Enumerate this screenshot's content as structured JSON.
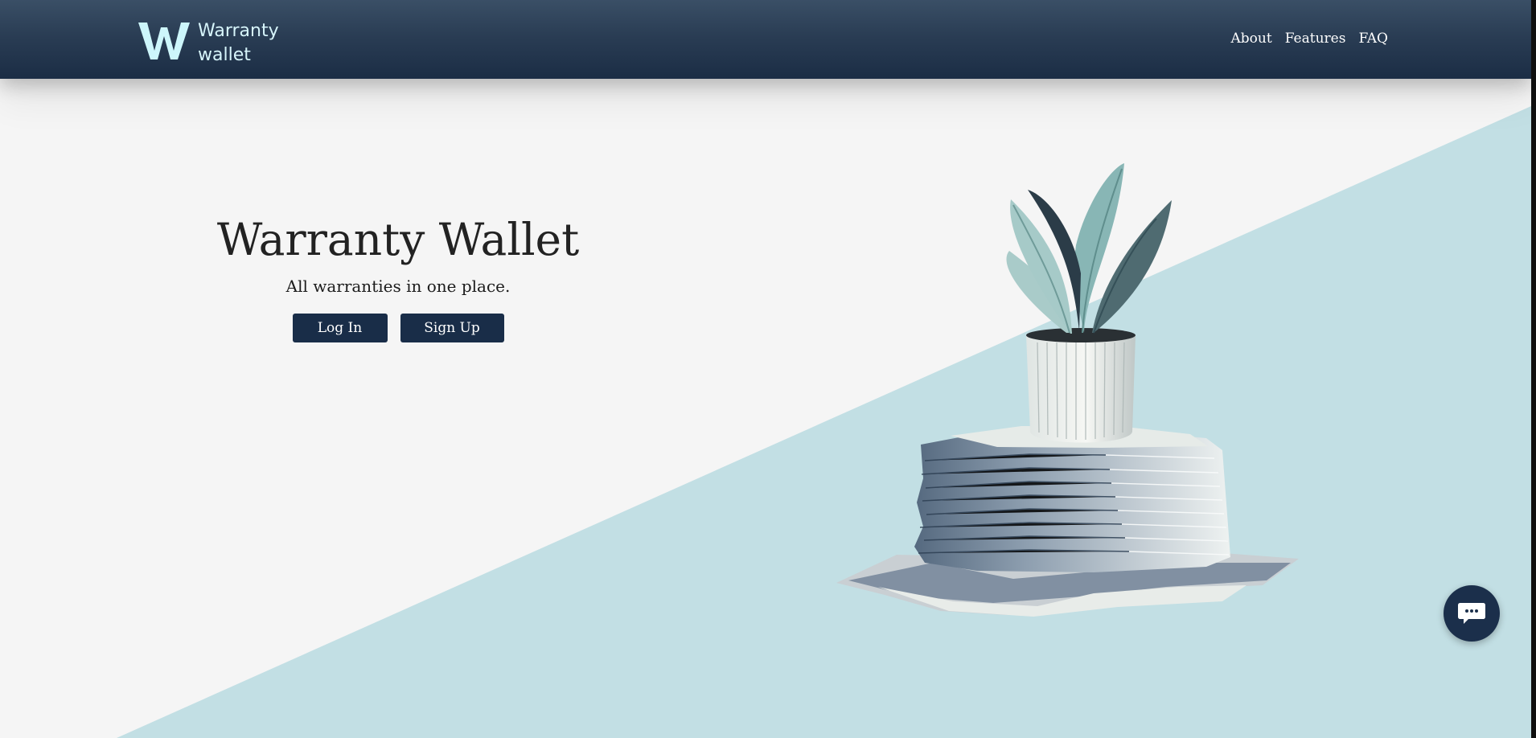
{
  "colors": {
    "header": "#1b2d45",
    "page_background": "#f5f5f5",
    "diagonal": "#c2dfe4",
    "button": "#192d48",
    "logo_accent": "#cdf6fb"
  },
  "header": {
    "logo": {
      "line1": "Warranty",
      "line2": "wallet",
      "icon": "w-logo-icon"
    },
    "nav": {
      "about": "About",
      "features": "Features",
      "faq": "FAQ"
    }
  },
  "hero": {
    "title": "Warranty Wallet",
    "subtitle": "All warranties in one place.",
    "login_label": "Log In",
    "signup_label": "Sign Up"
  },
  "illustration": {
    "subject": "plant-on-paper-stack-illustration"
  },
  "chat": {
    "icon": "chat-bubble-icon"
  }
}
